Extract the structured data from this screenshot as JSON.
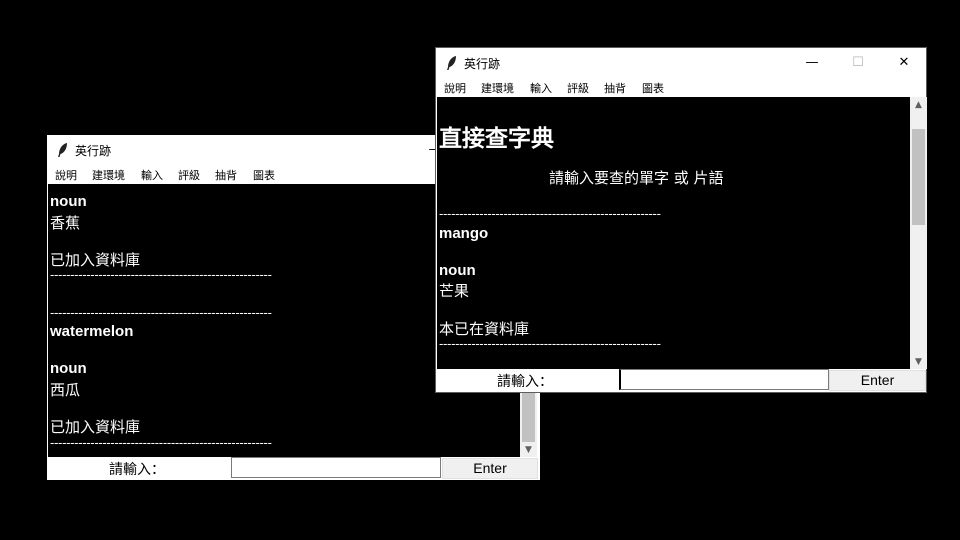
{
  "back_window": {
    "title": "英行跡",
    "menu": [
      "說明",
      "建環境",
      "輸入",
      "評級",
      "抽背",
      "圖表"
    ],
    "minimize": "—",
    "lines": [
      {
        "text": "noun",
        "style": "word"
      },
      {
        "text": "香蕉",
        "style": "normal"
      },
      {
        "text": "",
        "style": "normal"
      },
      {
        "text": "已加入資料庫",
        "style": "normal"
      },
      {
        "text": "-------------------------------------------------------",
        "style": "sep"
      },
      {
        "text": "",
        "style": "normal"
      },
      {
        "text": "-------------------------------------------------------",
        "style": "sep"
      },
      {
        "text": "watermelon",
        "style": "word"
      },
      {
        "text": "",
        "style": "normal"
      },
      {
        "text": "noun",
        "style": "word"
      },
      {
        "text": "西瓜",
        "style": "normal"
      },
      {
        "text": "",
        "style": "normal"
      },
      {
        "text": "已加入資料庫",
        "style": "normal"
      },
      {
        "text": "-------------------------------------------------------",
        "style": "sep"
      }
    ],
    "prompt_label": "請輸入：",
    "entry_value": "",
    "enter_label": "Enter"
  },
  "front_window": {
    "title": "英行跡",
    "menu": [
      "說明",
      "建環境",
      "輸入",
      "評級",
      "抽背",
      "圖表"
    ],
    "minimize": "—",
    "maximize": "☐",
    "close": "✕",
    "heading": "直接查字典",
    "subheading": "請輸入要查的單字 或 片語",
    "lines": [
      {
        "text": "-------------------------------------------------------",
        "style": "sep"
      },
      {
        "text": "mango",
        "style": "word"
      },
      {
        "text": "",
        "style": "normal"
      },
      {
        "text": "noun",
        "style": "word"
      },
      {
        "text": "芒果",
        "style": "normal"
      },
      {
        "text": "",
        "style": "normal"
      },
      {
        "text": "本已在資料庫",
        "style": "normal"
      },
      {
        "text": "-------------------------------------------------------",
        "style": "sep"
      }
    ],
    "prompt_label": "請輸入：",
    "entry_value": "",
    "enter_label": "Enter"
  },
  "icons": {
    "app": "feather-icon",
    "scroll_up": "arrow-up-icon",
    "scroll_down": "arrow-down-icon"
  },
  "colors": {
    "background": "#000000",
    "text_area": "#000000",
    "text": "#ffffff",
    "chrome": "#ffffff",
    "button": "#f0f0f0",
    "scroll_thumb": "#c1c1c1"
  }
}
